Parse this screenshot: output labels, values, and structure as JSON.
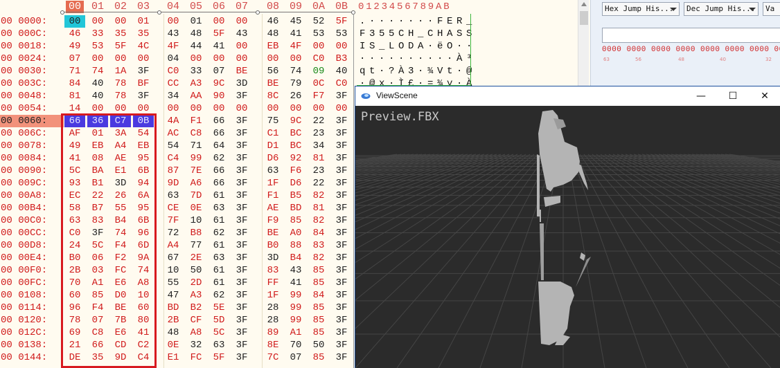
{
  "hex_editor": {
    "columns": [
      "00",
      "01",
      "02",
      "03",
      "04",
      "05",
      "06",
      "07",
      "08",
      "09",
      "0A",
      "0B"
    ],
    "ascii_header": "0123456789AB",
    "rows": [
      {
        "addr": "00 0000:",
        "bytes": [
          "00",
          "00",
          "00",
          "01",
          "00",
          "01",
          "00",
          "00",
          "46",
          "45",
          "52",
          "5F"
        ],
        "ascii": ".·······FER_"
      },
      {
        "addr": "00 000C:",
        "bytes": [
          "46",
          "33",
          "35",
          "35",
          "43",
          "48",
          "5F",
          "43",
          "48",
          "41",
          "53",
          "53"
        ],
        "ascii": "F355CH_CHASS"
      },
      {
        "addr": "00 0018:",
        "bytes": [
          "49",
          "53",
          "5F",
          "4C",
          "4F",
          "44",
          "41",
          "00",
          "EB",
          "4F",
          "00",
          "00"
        ],
        "ascii": "IS_LODA·ëO··"
      },
      {
        "addr": "00 0024:",
        "bytes": [
          "07",
          "00",
          "00",
          "00",
          "04",
          "00",
          "00",
          "00",
          "00",
          "00",
          "C0",
          "B3"
        ],
        "ascii": "··········À³"
      },
      {
        "addr": "00 0030:",
        "bytes": [
          "71",
          "74",
          "1A",
          "3F",
          "C0",
          "33",
          "07",
          "BE",
          "56",
          "74",
          "09",
          "40"
        ],
        "ascii": "qt·?À3·¾Vt·@"
      },
      {
        "addr": "00 003C:",
        "bytes": [
          "84",
          "40",
          "78",
          "BF",
          "CC",
          "A3",
          "9C",
          "3D",
          "BE",
          "79",
          "0C",
          "C0"
        ],
        "ascii": "·@x·Ì£·=¾y·À"
      },
      {
        "addr": "00 0048:",
        "bytes": [
          "81",
          "40",
          "78",
          "3F",
          "34",
          "AA",
          "90",
          "3F",
          "8C",
          "26",
          "F7",
          "3F"
        ],
        "ascii": ""
      },
      {
        "addr": "00 0054:",
        "bytes": [
          "14",
          "00",
          "00",
          "00",
          "00",
          "00",
          "00",
          "00",
          "00",
          "00",
          "00",
          "00"
        ],
        "ascii": ""
      },
      {
        "addr": "00 0060:",
        "bytes": [
          "66",
          "36",
          "C7",
          "0B",
          "4A",
          "F1",
          "66",
          "3F",
          "75",
          "9C",
          "22",
          "3F"
        ],
        "ascii": ""
      },
      {
        "addr": "00 006C:",
        "bytes": [
          "AF",
          "01",
          "3A",
          "54",
          "AC",
          "C8",
          "66",
          "3F",
          "C1",
          "BC",
          "23",
          "3F"
        ],
        "ascii": ""
      },
      {
        "addr": "00 0078:",
        "bytes": [
          "49",
          "EB",
          "A4",
          "EB",
          "54",
          "71",
          "64",
          "3F",
          "D1",
          "BC",
          "34",
          "3F"
        ],
        "ascii": ""
      },
      {
        "addr": "00 0084:",
        "bytes": [
          "41",
          "08",
          "AE",
          "95",
          "C4",
          "99",
          "62",
          "3F",
          "D6",
          "92",
          "81",
          "3F"
        ],
        "ascii": ""
      },
      {
        "addr": "00 0090:",
        "bytes": [
          "5C",
          "BA",
          "E1",
          "6B",
          "87",
          "7E",
          "66",
          "3F",
          "63",
          "F6",
          "23",
          "3F"
        ],
        "ascii": ""
      },
      {
        "addr": "00 009C:",
        "bytes": [
          "93",
          "B1",
          "3D",
          "94",
          "9D",
          "A6",
          "66",
          "3F",
          "1F",
          "D6",
          "22",
          "3F"
        ],
        "ascii": ""
      },
      {
        "addr": "00 00A8:",
        "bytes": [
          "EC",
          "22",
          "26",
          "6A",
          "63",
          "7D",
          "61",
          "3F",
          "F1",
          "B5",
          "82",
          "3F"
        ],
        "ascii": ""
      },
      {
        "addr": "00 00B4:",
        "bytes": [
          "58",
          "B7",
          "55",
          "95",
          "CE",
          "0E",
          "63",
          "3F",
          "AE",
          "BD",
          "81",
          "3F"
        ],
        "ascii": ""
      },
      {
        "addr": "00 00C0:",
        "bytes": [
          "63",
          "83",
          "B4",
          "6B",
          "7F",
          "10",
          "61",
          "3F",
          "F9",
          "85",
          "82",
          "3F"
        ],
        "ascii": ""
      },
      {
        "addr": "00 00CC:",
        "bytes": [
          "C0",
          "3F",
          "74",
          "96",
          "72",
          "B8",
          "62",
          "3F",
          "BE",
          "A0",
          "84",
          "3F"
        ],
        "ascii": ""
      },
      {
        "addr": "00 00D8:",
        "bytes": [
          "24",
          "5C",
          "F4",
          "6D",
          "A4",
          "77",
          "61",
          "3F",
          "B0",
          "88",
          "83",
          "3F"
        ],
        "ascii": ""
      },
      {
        "addr": "00 00E4:",
        "bytes": [
          "B0",
          "06",
          "F2",
          "9A",
          "67",
          "2E",
          "63",
          "3F",
          "3D",
          "B4",
          "82",
          "3F"
        ],
        "ascii": ""
      },
      {
        "addr": "00 00F0:",
        "bytes": [
          "2B",
          "03",
          "FC",
          "74",
          "10",
          "50",
          "61",
          "3F",
          "83",
          "43",
          "85",
          "3F"
        ],
        "ascii": ""
      },
      {
        "addr": "00 00FC:",
        "bytes": [
          "70",
          "A1",
          "E6",
          "A8",
          "55",
          "2D",
          "61",
          "3F",
          "FF",
          "41",
          "85",
          "3F"
        ],
        "ascii": ""
      },
      {
        "addr": "00 0108:",
        "bytes": [
          "60",
          "85",
          "D0",
          "10",
          "47",
          "A3",
          "62",
          "3F",
          "1F",
          "99",
          "84",
          "3F"
        ],
        "ascii": ""
      },
      {
        "addr": "00 0114:",
        "bytes": [
          "96",
          "F4",
          "BE",
          "60",
          "BD",
          "B2",
          "5E",
          "3F",
          "28",
          "99",
          "85",
          "3F"
        ],
        "ascii": ""
      },
      {
        "addr": "00 0120:",
        "bytes": [
          "78",
          "07",
          "7B",
          "80",
          "2B",
          "CF",
          "5D",
          "3F",
          "28",
          "99",
          "85",
          "3F"
        ],
        "ascii": ""
      },
      {
        "addr": "00 012C:",
        "bytes": [
          "69",
          "C8",
          "E6",
          "41",
          "48",
          "A8",
          "5C",
          "3F",
          "89",
          "A1",
          "85",
          "3F"
        ],
        "ascii": ""
      },
      {
        "addr": "00 0138:",
        "bytes": [
          "21",
          "66",
          "CD",
          "C2",
          "0E",
          "32",
          "63",
          "3F",
          "8E",
          "70",
          "50",
          "3F"
        ],
        "ascii": ""
      },
      {
        "addr": "00 0144:",
        "bytes": [
          "DE",
          "35",
          "9D",
          "C4",
          "E1",
          "FC",
          "5F",
          "3F",
          "7C",
          "07",
          "85",
          "3F"
        ],
        "ascii": ""
      }
    ]
  },
  "toolbar": {
    "hex_jump": "Hex Jump His...",
    "dec_jump": "Dec Jump His...",
    "value_jump": "Va",
    "bits": "0000 0000  0000 0000  0000 0000  0000 0000  00",
    "bit_numbers": [
      "63",
      "56",
      "48",
      "40",
      "32"
    ]
  },
  "viewscene": {
    "title": "ViewScene",
    "caption": "Preview.FBX",
    "minimize": "—",
    "maximize": "☐",
    "close": "✕"
  },
  "colors": {
    "hex_text": "#d01b1b",
    "selection": "#4a3ae0",
    "cursor": "#22c6d8",
    "highlight_box": "#d7191f",
    "viewport_bg": "#2b2b2b",
    "model": "#b4b4b4"
  }
}
